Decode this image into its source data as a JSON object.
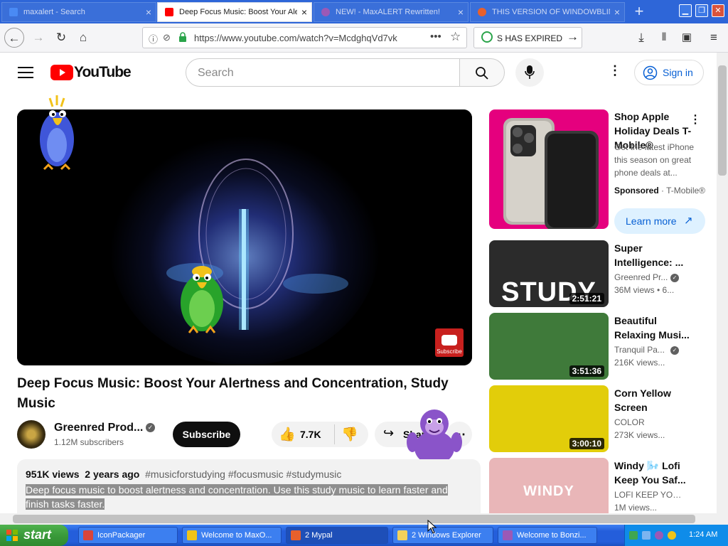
{
  "browser": {
    "tabs": [
      {
        "title": "maxalert - Search",
        "state": "inactive",
        "icon_color": "#4a8af4"
      },
      {
        "title": "Deep Focus Music: Boost Your Alertness",
        "state": "active",
        "icon_color": "#ff0000"
      },
      {
        "title": "NEW! - MaxALERT Rewritten!",
        "state": "inactive",
        "icon_color": "#9b59b6"
      },
      {
        "title": "THIS VERSION OF WINDOWBLINDS",
        "state": "inactive",
        "icon_color": "#e8602c"
      }
    ],
    "url": "https://www.youtube.com/watch?v=McdghqVd7vk",
    "expired_text": "S HAS EXPIRED",
    "new_tab_symbol": "+",
    "close_symbol": "×"
  },
  "youtube": {
    "logo_text": "YouTube",
    "search_placeholder": "Search",
    "sign_in": "Sign in",
    "video_title": "Deep Focus Music: Boost Your Alertness and Concentration, Study Music",
    "channel_name": "Greenred Prod...",
    "subscribers": "1.12M subscribers",
    "subscribe": "Subscribe",
    "likes": "7.7K",
    "share": "Share",
    "meta_views": "951K views",
    "meta_date": "2 years ago",
    "meta_tags": "#musicforstudying #focusmusic #studymusic",
    "description": "Deep focus music to boost alertness and concentration. Use this study music to learn faster and finish tasks faster.",
    "overlay_subscribe": "Subscribe",
    "ad": {
      "title": "Shop Apple Holiday Deals T-Mobile®",
      "desc": "Get the latest iPhone this season on great phone deals at...",
      "sponsored": "Sponsored",
      "advertiser": "T-Mobile®",
      "learn_more": "Learn more"
    },
    "recommendations": [
      {
        "title": "Super Intelligence: ...",
        "channel": "Greenred Pr...",
        "verified": true,
        "stats": "36M views • 6...",
        "duration": "2:51:21",
        "thumb_text": "STUDY",
        "thumb_color": "#2b2b2b"
      },
      {
        "title": "Beautiful Relaxing Musi...",
        "channel": "Tranquil Pa...",
        "verified": true,
        "stats": "216K views...",
        "duration": "3:51:36",
        "thumb_text": "",
        "thumb_color": "#3f7a3a"
      },
      {
        "title": "Corn Yellow Screen",
        "channel": "COLOR",
        "verified": false,
        "stats": "273K views...",
        "duration": "3:00:10",
        "thumb_text": "",
        "thumb_color": "#e2cd0a"
      },
      {
        "title": "Windy 🌬️ Lofi Keep You Saf...",
        "channel": "LOFI KEEP YOU ...",
        "verified": false,
        "stats": "1M views...",
        "duration": "",
        "thumb_text": "WINDY",
        "thumb_color": "#e9b6b8"
      }
    ]
  },
  "taskbar": {
    "start": "start",
    "items": [
      {
        "label": "IconPackager",
        "pressed": false,
        "icon_color": "#d9453c"
      },
      {
        "label": "Welcome to MaxO...",
        "pressed": false,
        "icon_color": "#f0c419"
      },
      {
        "label": "2 Mypal",
        "pressed": true,
        "icon_color": "#e8602c"
      },
      {
        "label": "2 Windows Explorer",
        "pressed": false,
        "icon_color": "#f2d15c"
      },
      {
        "label": "Welcome to Bonzi...",
        "pressed": false,
        "icon_color": "#9b59b6"
      }
    ],
    "clock": "1:24 AM"
  },
  "colors": {
    "youtube_red": "#ff0000",
    "xp_blue": "#245edb",
    "start_green": "#3a9a3a",
    "signin_blue": "#065fd4"
  }
}
